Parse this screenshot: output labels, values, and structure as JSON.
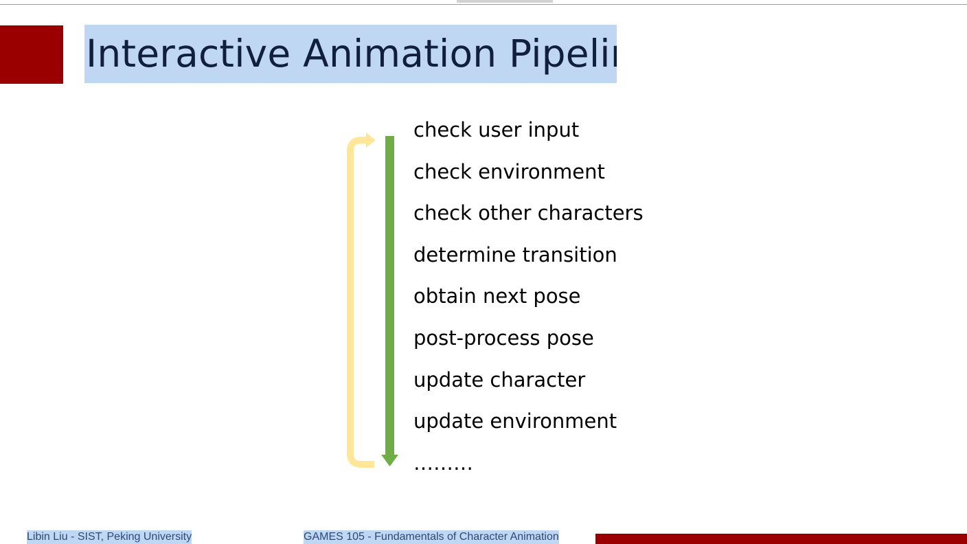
{
  "slide": {
    "title": "Interactive Animation Pipeline",
    "steps": [
      "check user input",
      "check environment",
      "check other characters",
      "determine transition",
      "obtain next pose",
      "post-process pose",
      "update character",
      "update environment",
      "………"
    ],
    "footer_left": "Libin Liu - SIST, Peking University",
    "footer_center": "GAMES 105 - Fundamentals of Character Animation"
  },
  "colors": {
    "accent_red": "#9b0000",
    "selection_blue": "#bfd7f3",
    "flow_arrow_green": "#70ad47",
    "loop_arrow_yellow": "#ffe699"
  }
}
